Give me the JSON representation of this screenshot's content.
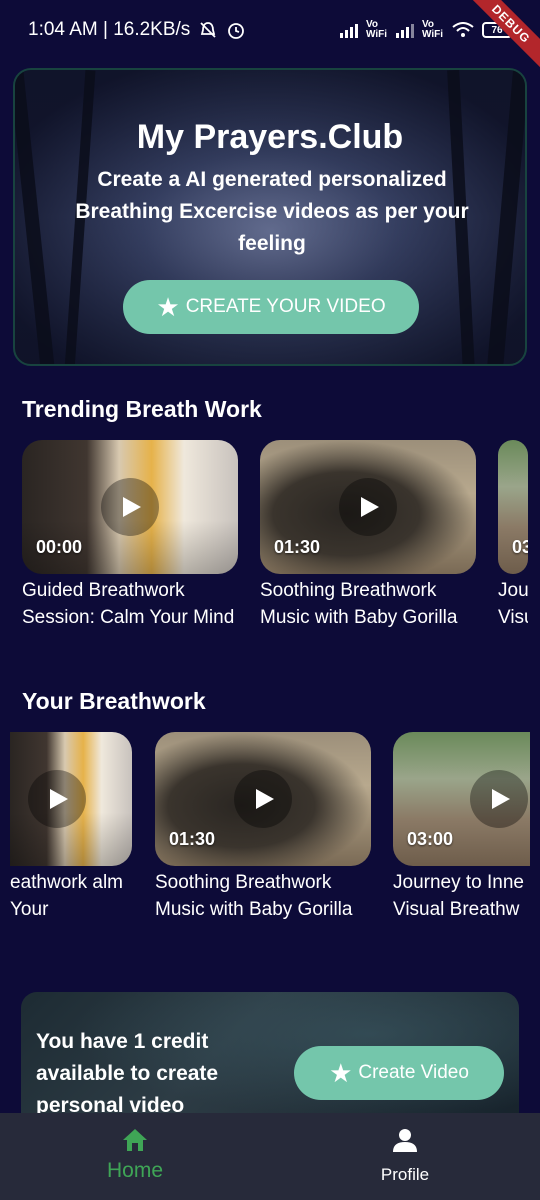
{
  "status_bar": {
    "time_speed": "1:04 AM | 16.2KB/s",
    "vowifi_1": "Vo WiFi",
    "vowifi_2": "Vo WiFi",
    "battery": "76",
    "debug": "DEBUG"
  },
  "hero": {
    "title": "My Prayers.Club",
    "subtitle": "Create a AI generated personalized Breathing Excercise videos as per your feeling",
    "button_label": "CREATE YOUR VIDEO"
  },
  "trending": {
    "title": "Trending Breath Work",
    "items": [
      {
        "duration": "00:00",
        "title": "Guided Breathwork Session: Calm Your Mind"
      },
      {
        "duration": "01:30",
        "title": "Soothing Breathwork Music with Baby Gorilla"
      },
      {
        "duration": "03",
        "title": "Jou Visu"
      }
    ]
  },
  "yours": {
    "title": "Your Breathwork",
    "items": [
      {
        "duration": "",
        "title": "eathwork alm Your"
      },
      {
        "duration": "01:30",
        "title": "Soothing Breathwork Music with Baby Gorilla"
      },
      {
        "duration": "03:00",
        "title": "Journey to Inne Visual Breathw"
      }
    ]
  },
  "credit": {
    "text": "You have 1 credit available to create personal video",
    "button_label": "Create Video"
  },
  "bottom_nav": {
    "home_label": "Home",
    "profile_label": "Profile"
  },
  "colors": {
    "background": "#0d0b38",
    "accent": "#74c6ab",
    "nav_active": "#3fa556",
    "nav_bg": "#272a3a"
  }
}
